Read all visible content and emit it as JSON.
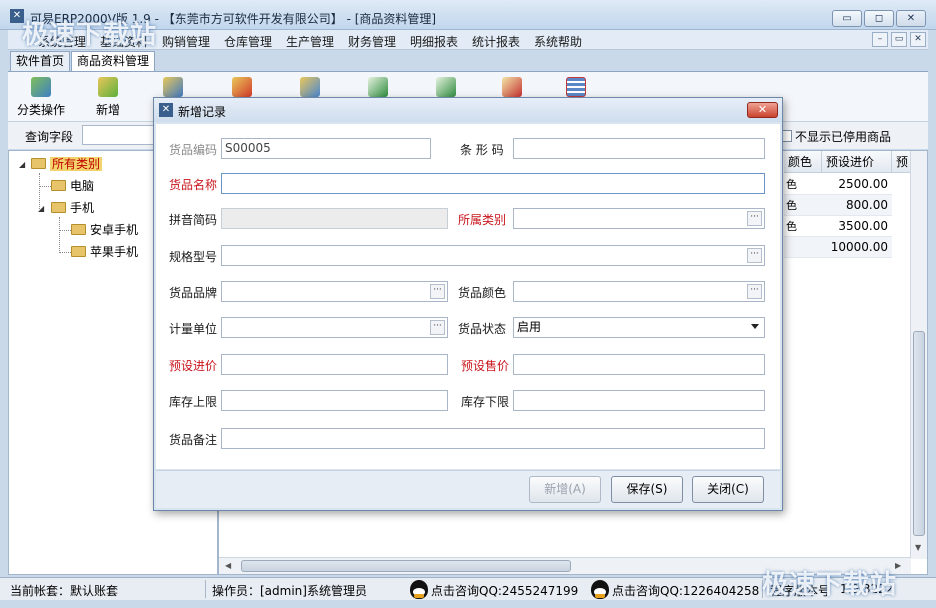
{
  "window": {
    "title": "可易ERP2000V版 1.9 - 【东莞市方可软件开发有限公司】 - [商品资料管理]",
    "min_glyph": "▭",
    "max_glyph": "◻",
    "close_glyph": "✕"
  },
  "menu": [
    "系统管理",
    "基础资料",
    "购销管理",
    "仓库管理",
    "生产管理",
    "财务管理",
    "明细报表",
    "统计报表",
    "系统帮助"
  ],
  "tabs": [
    "软件首页",
    "商品资料管理"
  ],
  "toolbar": [
    "分类操作",
    "新增"
  ],
  "query": {
    "label": "查询字段",
    "hide_disabled_label": "不显示已停用商品"
  },
  "tree": {
    "root": "所有类别",
    "children": [
      {
        "label": "电脑"
      },
      {
        "label": "手机",
        "children": [
          "安卓手机",
          "苹果手机"
        ]
      }
    ]
  },
  "grid": {
    "columns": [
      "颜色",
      "预设进价",
      "预"
    ],
    "rows": [
      {
        "color": "色",
        "price": "2500.00"
      },
      {
        "color": "色",
        "price": "800.00"
      },
      {
        "color": "色",
        "price": "3500.00"
      },
      {
        "color": "",
        "price": "10000.00"
      }
    ]
  },
  "status": {
    "account": "当前帐套：默认账套",
    "operator": "操作员：[admin]系统管理员",
    "qq1": "点击咨询QQ:2455247199",
    "qq2": "点击咨询QQ:1226404258",
    "version_label": "程序版本号",
    "version": "1.9.3222"
  },
  "watermark": {
    "top_left": "极速下载站",
    "bottom_right": "极速下载站"
  },
  "dialog": {
    "title": "新增记录",
    "fields": {
      "code": {
        "label": "货品编码",
        "value": "S00005"
      },
      "barcode": {
        "label": "条 形 码",
        "value": ""
      },
      "name": {
        "label": "货品名称",
        "value": ""
      },
      "pinyin": {
        "label": "拼音简码",
        "value": ""
      },
      "category": {
        "label": "所属类别",
        "value": ""
      },
      "spec": {
        "label": "规格型号",
        "value": ""
      },
      "brand": {
        "label": "货品品牌",
        "value": ""
      },
      "color": {
        "label": "货品颜色",
        "value": ""
      },
      "unit": {
        "label": "计量单位",
        "value": ""
      },
      "status": {
        "label": "货品状态",
        "value": "启用"
      },
      "buy_price": {
        "label": "预设进价",
        "value": ""
      },
      "sell_price": {
        "label": "预设售价",
        "value": ""
      },
      "stock_max": {
        "label": "库存上限",
        "value": ""
      },
      "stock_min": {
        "label": "库存下限",
        "value": ""
      },
      "remark": {
        "label": "货品备注",
        "value": ""
      }
    },
    "buttons": {
      "add": "新增(A)",
      "save": "保存(S)",
      "close": "关闭(C)"
    },
    "ellipsis": "···"
  },
  "colors": {
    "required_label": "#c8161d",
    "selected_node_bg": "#f3d36b",
    "dialog_close": "#c9432e"
  }
}
